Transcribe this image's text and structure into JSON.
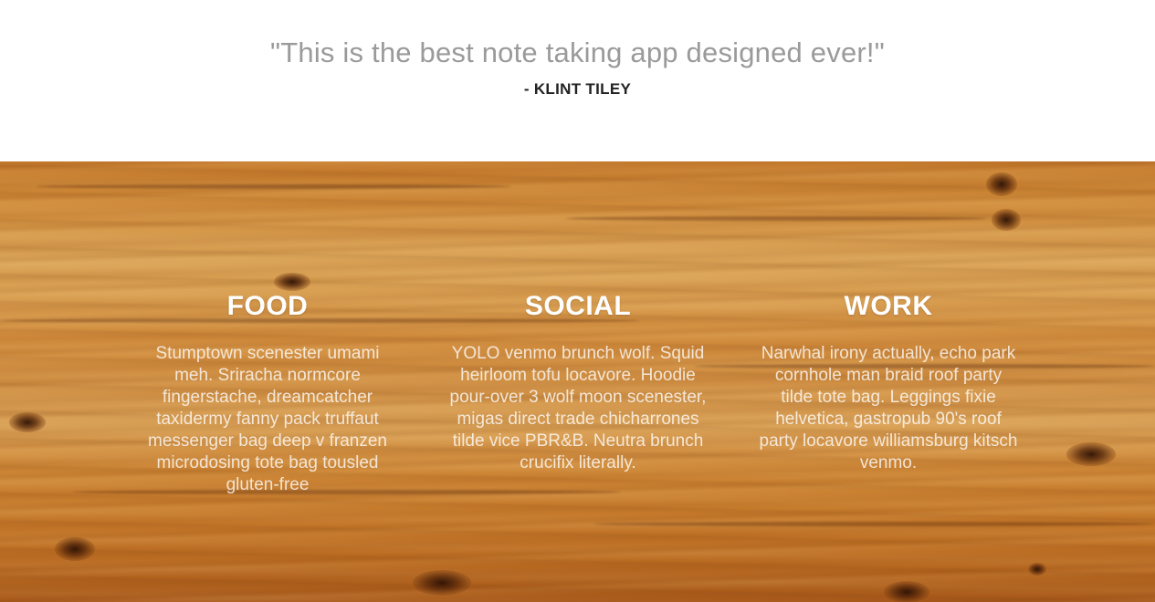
{
  "testimonial": {
    "quote": "\"This is the best note taking app designed ever!\"",
    "author": "- KLINT TILEY"
  },
  "features": [
    {
      "title": "FOOD",
      "text": "Stumptown scenester umami meh. Sriracha normcore fingerstache, dreamcatcher taxidermy fanny pack truffaut messenger bag deep v franzen microdosing tote bag tousled gluten-free"
    },
    {
      "title": "SOCIAL",
      "text": "YOLO venmo brunch wolf. Squid heirloom tofu locavore. Hoodie pour-over 3 wolf moon scenester, migas direct trade chicharrones tilde vice PBR&B. Neutra brunch crucifix literally."
    },
    {
      "title": "WORK",
      "text": "Narwhal irony actually, echo park cornhole man braid roof party tilde tote bag. Leggings fixie helvetica, gastropub 90's roof party locavore williamsburg kitsch venmo."
    }
  ]
}
